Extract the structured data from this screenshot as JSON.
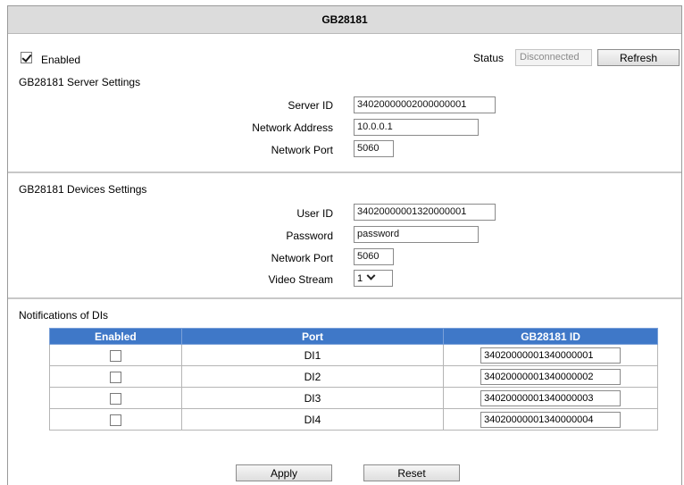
{
  "title": "GB28181",
  "enabled": {
    "label": "Enabled",
    "checked": true
  },
  "status": {
    "label": "Status",
    "value": "Disconnected",
    "refresh_label": "Refresh"
  },
  "server": {
    "heading": "GB28181 Server Settings",
    "server_id_label": "Server ID",
    "server_id_value": "34020000002000000001",
    "address_label": "Network Address",
    "address_value": "10.0.0.1",
    "port_label": "Network Port",
    "port_value": "5060"
  },
  "devices": {
    "heading": "GB28181 Devices Settings",
    "user_id_label": "User ID",
    "user_id_value": "34020000001320000001",
    "password_label": "Password",
    "password_value": "password",
    "port_label": "Network Port",
    "port_value": "5060",
    "stream_label": "Video Stream",
    "stream_value": "1"
  },
  "notifications": {
    "heading": "Notifications of DIs",
    "columns": [
      "Enabled",
      "Port",
      "GB28181 ID"
    ],
    "rows": [
      {
        "enabled": false,
        "port": "DI1",
        "id": "34020000001340000001"
      },
      {
        "enabled": false,
        "port": "DI2",
        "id": "34020000001340000002"
      },
      {
        "enabled": false,
        "port": "DI3",
        "id": "34020000001340000003"
      },
      {
        "enabled": false,
        "port": "DI4",
        "id": "34020000001340000004"
      }
    ]
  },
  "actions": {
    "apply_label": "Apply",
    "reset_label": "Reset"
  },
  "colors": {
    "table_header": "#3f78c8",
    "title_bar": "#dcdcdc"
  }
}
